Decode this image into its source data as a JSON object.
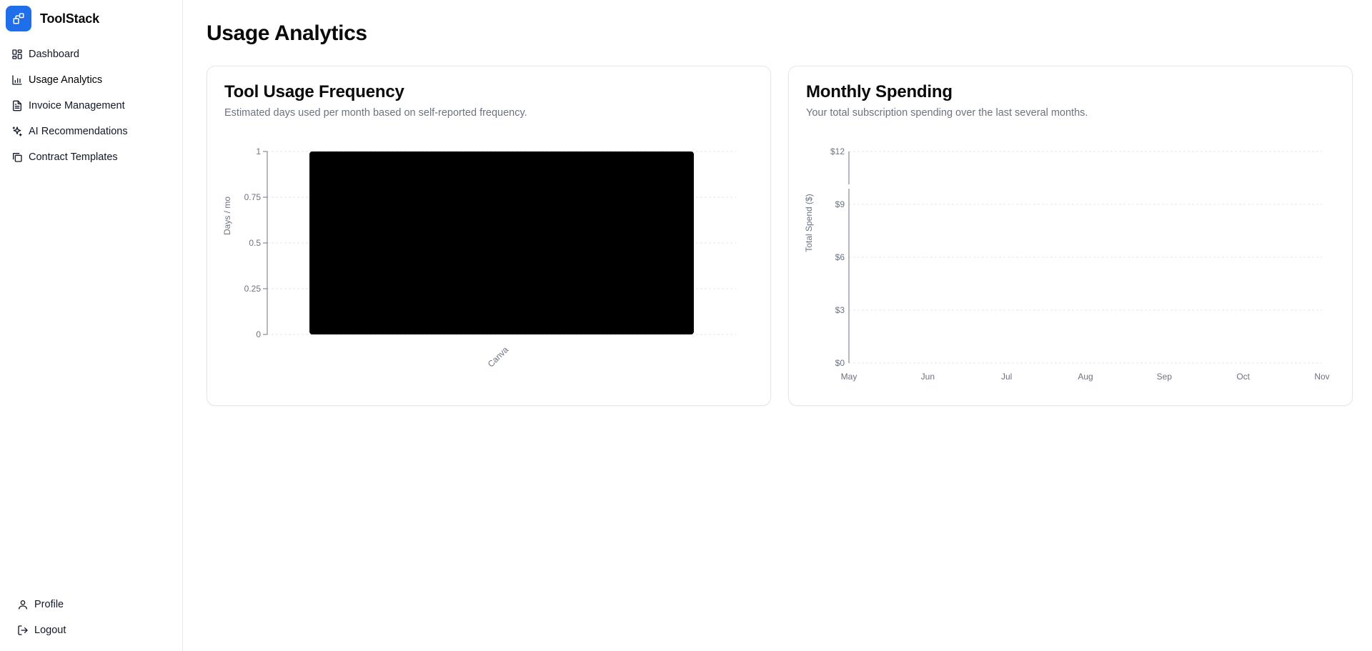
{
  "app": {
    "name": "ToolStack"
  },
  "sidebar": {
    "items": [
      {
        "label": "Dashboard",
        "icon": "dashboard-icon"
      },
      {
        "label": "Usage Analytics",
        "icon": "bar-chart-icon"
      },
      {
        "label": "Invoice Management",
        "icon": "file-text-icon"
      },
      {
        "label": "AI Recommendations",
        "icon": "sparkles-icon"
      },
      {
        "label": "Contract Templates",
        "icon": "copy-icon"
      }
    ],
    "bottom": [
      {
        "label": "Profile",
        "icon": "user-icon"
      },
      {
        "label": "Logout",
        "icon": "logout-icon"
      }
    ]
  },
  "page": {
    "title": "Usage Analytics"
  },
  "cards": {
    "usage": {
      "title": "Tool Usage Frequency",
      "description": "Estimated days used per month based on self-reported frequency."
    },
    "spending": {
      "title": "Monthly Spending",
      "description": "Your total subscription spending over the last several months."
    }
  },
  "colors": {
    "accent": "#1f6feb",
    "bar": "#000000",
    "grid": "#e5e7eb",
    "axis": "#6b7280"
  },
  "chart_data": [
    {
      "type": "bar",
      "categories": [
        "Canva"
      ],
      "values": [
        1
      ],
      "ylabel": "Days / mo",
      "ylim": [
        0,
        1
      ],
      "yticks": [
        0,
        0.25,
        0.5,
        0.75,
        1
      ],
      "ytick_labels": [
        "0",
        "0.25",
        "0.5",
        "0.75",
        "1"
      ],
      "grid": true
    },
    {
      "type": "line",
      "x": [
        "May",
        "Jun",
        "Jul",
        "Aug",
        "Sep",
        "Oct",
        "Nov"
      ],
      "series": [
        {
          "values": []
        }
      ],
      "ylabel": "Total Spend ($)",
      "ylim": [
        0,
        12
      ],
      "yticks": [
        0,
        3,
        6,
        9,
        12
      ],
      "ytick_labels": [
        "$0",
        "$3",
        "$6",
        "$9",
        "$12"
      ],
      "grid": true
    }
  ]
}
